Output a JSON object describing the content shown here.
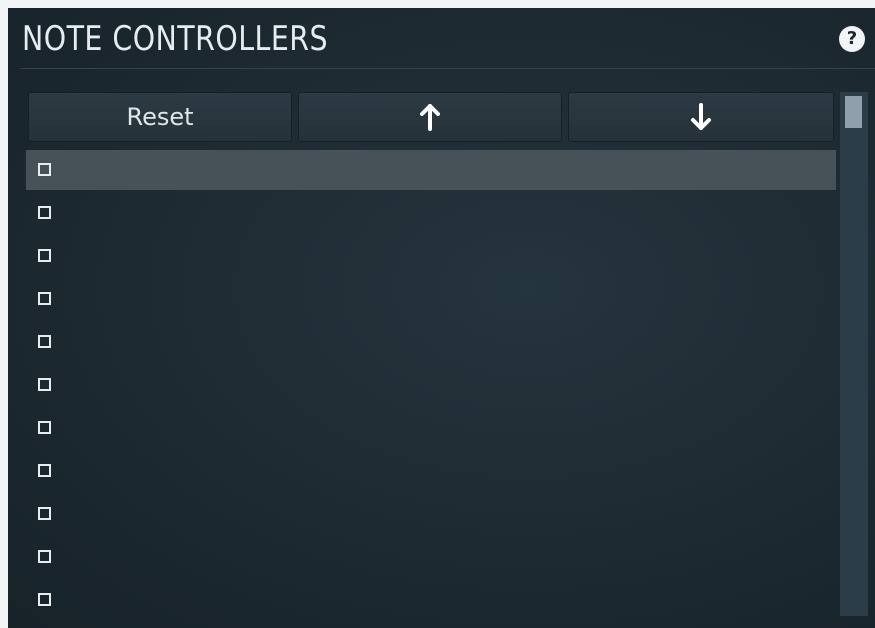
{
  "panel": {
    "title": "NOTE CONTROLLERS",
    "help_label": "?"
  },
  "toolbar": {
    "reset_label": "Reset",
    "move_up_icon": "arrow-up-icon",
    "move_down_icon": "arrow-down-icon"
  },
  "list": {
    "rows": [
      {
        "checked": false,
        "label": "",
        "selected": true
      },
      {
        "checked": false,
        "label": "",
        "selected": false
      },
      {
        "checked": false,
        "label": "",
        "selected": false
      },
      {
        "checked": false,
        "label": "",
        "selected": false
      },
      {
        "checked": false,
        "label": "",
        "selected": false
      },
      {
        "checked": false,
        "label": "",
        "selected": false
      },
      {
        "checked": false,
        "label": "",
        "selected": false
      },
      {
        "checked": false,
        "label": "",
        "selected": false
      },
      {
        "checked": false,
        "label": "",
        "selected": false
      },
      {
        "checked": false,
        "label": "",
        "selected": false
      },
      {
        "checked": false,
        "label": "",
        "selected": false
      }
    ]
  },
  "colors": {
    "panel_bg": "#1d2a32",
    "selected_row": "#465257",
    "button_bg": "#2a3841",
    "text": "#e6ecef",
    "scrollbar_track": "#2c3d4a",
    "scrollbar_thumb": "#8fa0aa"
  }
}
